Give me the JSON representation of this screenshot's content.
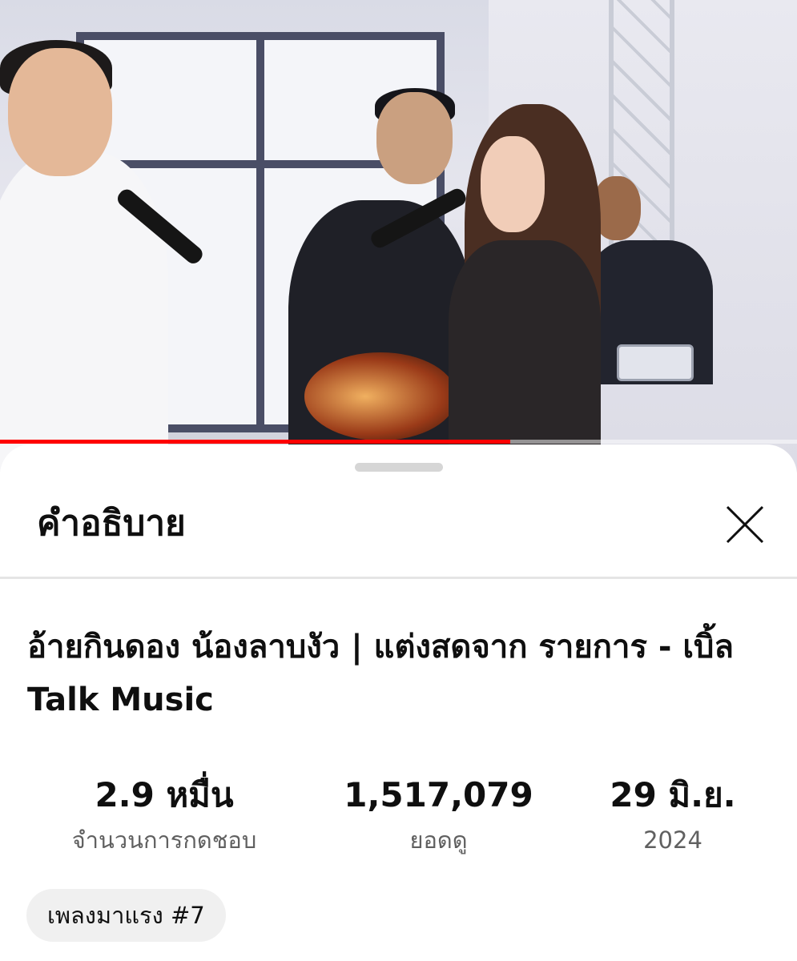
{
  "player": {
    "progress_fraction": 0.64,
    "progress_color": "#ff0000"
  },
  "sheet": {
    "title": "คำอธิบาย",
    "close_icon": "close-icon"
  },
  "video": {
    "title": "อ้ายกินดอง น้องลาบงัว | แต่งสดจาก รายการ - เบิ้ล Talk Music"
  },
  "stats": {
    "likes": {
      "value": "2.9 หมื่น",
      "label": "จำนวนการกดชอบ"
    },
    "views": {
      "value": "1,517,079",
      "label": "ยอดดู"
    },
    "date": {
      "value": "29 มิ.ย.",
      "label": "2024"
    }
  },
  "chip": {
    "label": "เพลงมาแรง #7"
  }
}
